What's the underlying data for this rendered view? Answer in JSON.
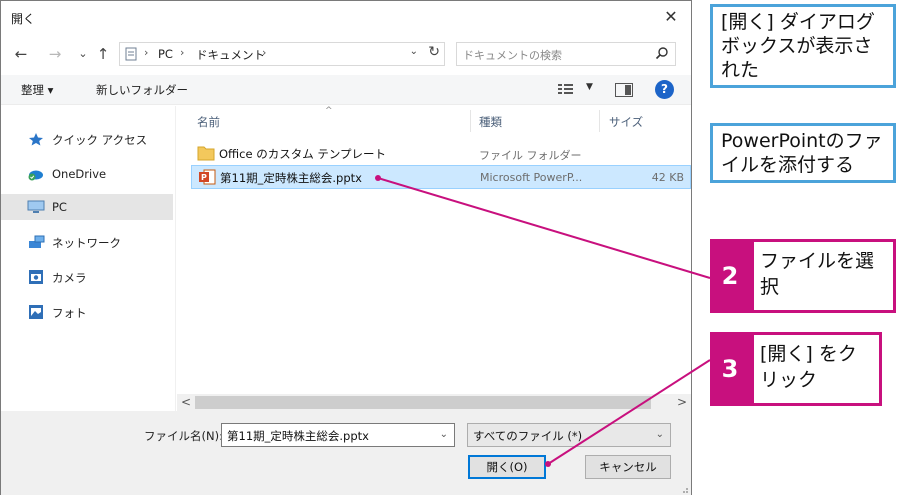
{
  "dialog": {
    "title": "開く",
    "close_glyph": "✕",
    "nav": {
      "back": "←",
      "forward": "→",
      "dropdown": "⌄",
      "up": "↑"
    },
    "address": {
      "crumbs": [
        "PC",
        "ドキュメント"
      ],
      "separator": "›",
      "dropdown": "⌄",
      "refresh": "↻"
    },
    "search": {
      "placeholder": "ドキュメントの検索"
    },
    "toolbar": {
      "organize": "整理 ▾",
      "new_folder": "新しいフォルダー",
      "view_dropdown": "▼",
      "help": "?"
    },
    "sidebar": [
      {
        "label": "クイック アクセス",
        "icon": "star-icon"
      },
      {
        "label": "OneDrive",
        "icon": "cloud-icon"
      },
      {
        "label": "PC",
        "icon": "monitor-icon",
        "selected": true
      },
      {
        "label": "ネットワーク",
        "icon": "network-icon"
      },
      {
        "label": "カメラ",
        "icon": "camera-folder-icon"
      },
      {
        "label": "フォト",
        "icon": "pictures-folder-icon"
      }
    ],
    "columns": {
      "name": "名前",
      "type": "種類",
      "size": "サイズ",
      "sort_glyph": "^"
    },
    "files": [
      {
        "name": "Office のカスタム テンプレート",
        "type": "ファイル フォルダー",
        "size": "",
        "icon": "folder-icon",
        "selected": false
      },
      {
        "name": "第11期_定時株主総会.pptx",
        "type": "Microsoft PowerP...",
        "size": "42 KB",
        "icon": "powerpoint-file-icon",
        "selected": true
      }
    ],
    "scrollbar": {
      "left": "<",
      "right": ">"
    },
    "bottom": {
      "filename_label": "ファイル名(N):",
      "filename_value": "第11期_定時株主総会.pptx",
      "filetype_value": "すべてのファイル (*)",
      "open_button": "開く(O)",
      "cancel_button": "キャンセル",
      "dropdown_glyph": "⌄"
    }
  },
  "annotations": {
    "note1": "[開く] ダイアログボックスが表示された",
    "note2": "PowerPointのファイルを添付する",
    "step2": {
      "number": "2",
      "text": "ファイルを選択"
    },
    "step3": {
      "number": "3",
      "text": "[開く] をクリック"
    }
  },
  "colors": {
    "note_border": "#4ba3da",
    "step_accent": "#c8107e",
    "selection": "#cce8ff",
    "primary_button_border": "#0078d7"
  }
}
